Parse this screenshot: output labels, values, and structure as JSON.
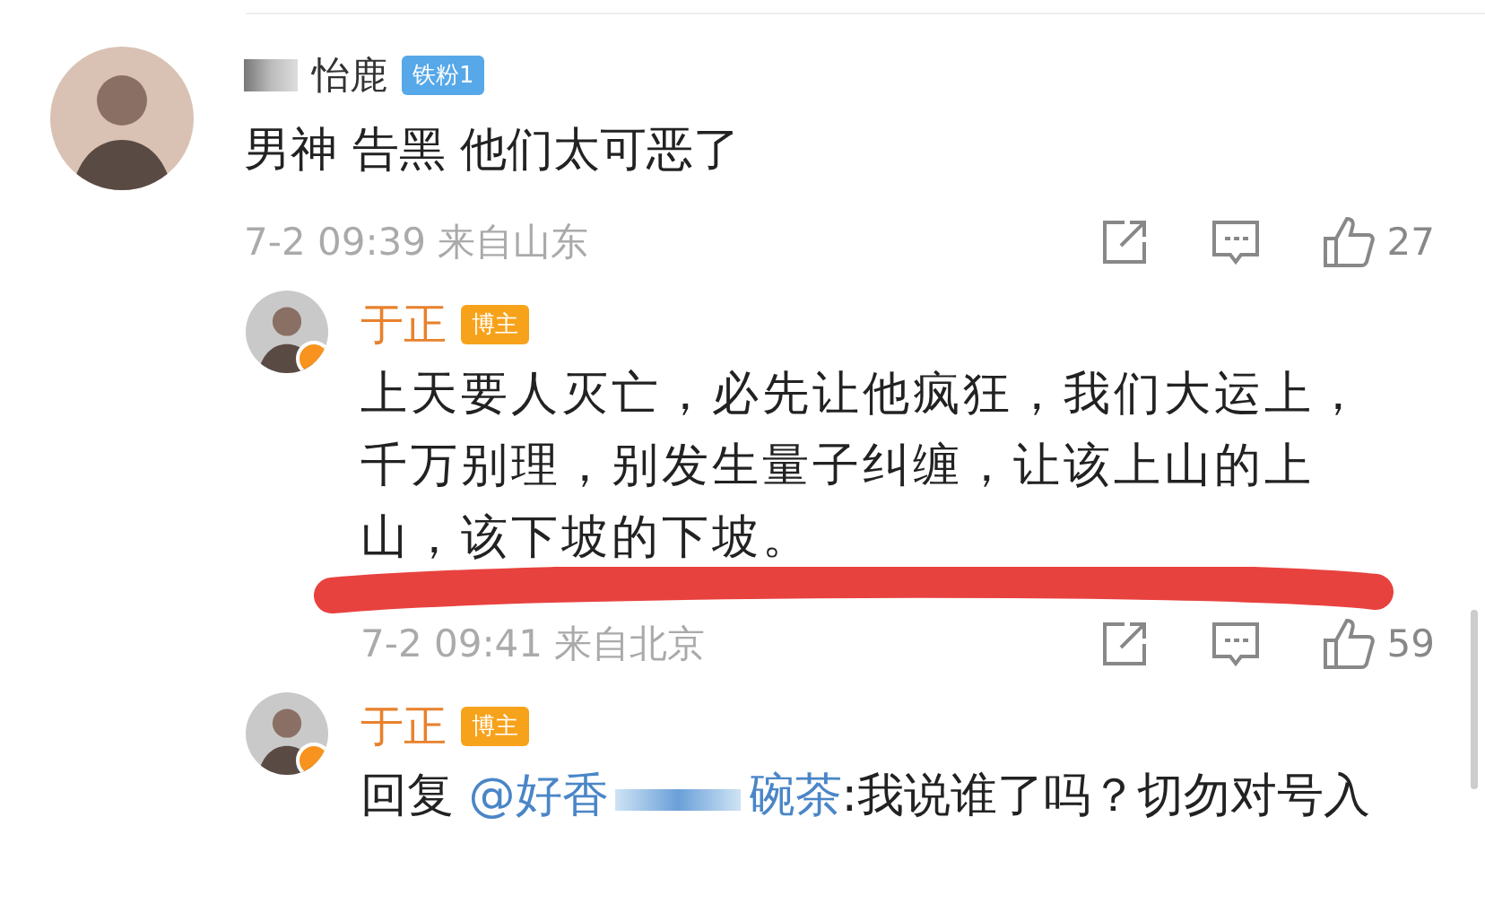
{
  "comments": [
    {
      "kind": "top",
      "name": "怡鹿",
      "name_redacted": true,
      "verified": false,
      "badge": {
        "kind": "fan",
        "label": "铁粉1"
      },
      "body": {
        "kind": "plain",
        "text": "男神 告黑 他们太可恶了"
      },
      "time": "7-2 09:39",
      "location": "来自山东",
      "likes": "27"
    },
    {
      "kind": "reply",
      "name": "于正",
      "verified": true,
      "badge": {
        "kind": "blogger",
        "label": "博主"
      },
      "body": {
        "kind": "plain",
        "text": "上天要人灭亡，必先让他疯狂，我们大运上，千万别理，别发生量子纠缠，让该上山的上山，该下坡的下坡。"
      },
      "time": "7-2 09:41",
      "location": "来自北京",
      "likes": "59",
      "scribbled": true
    },
    {
      "kind": "reply",
      "name": "于正",
      "verified": true,
      "badge": {
        "kind": "blogger",
        "label": "博主"
      },
      "body": {
        "kind": "reply",
        "prefix": "回复",
        "mention_start": "@好香",
        "mention_end": "碗茶",
        "text": ":我说谁了吗？切勿对号入"
      }
    }
  ]
}
